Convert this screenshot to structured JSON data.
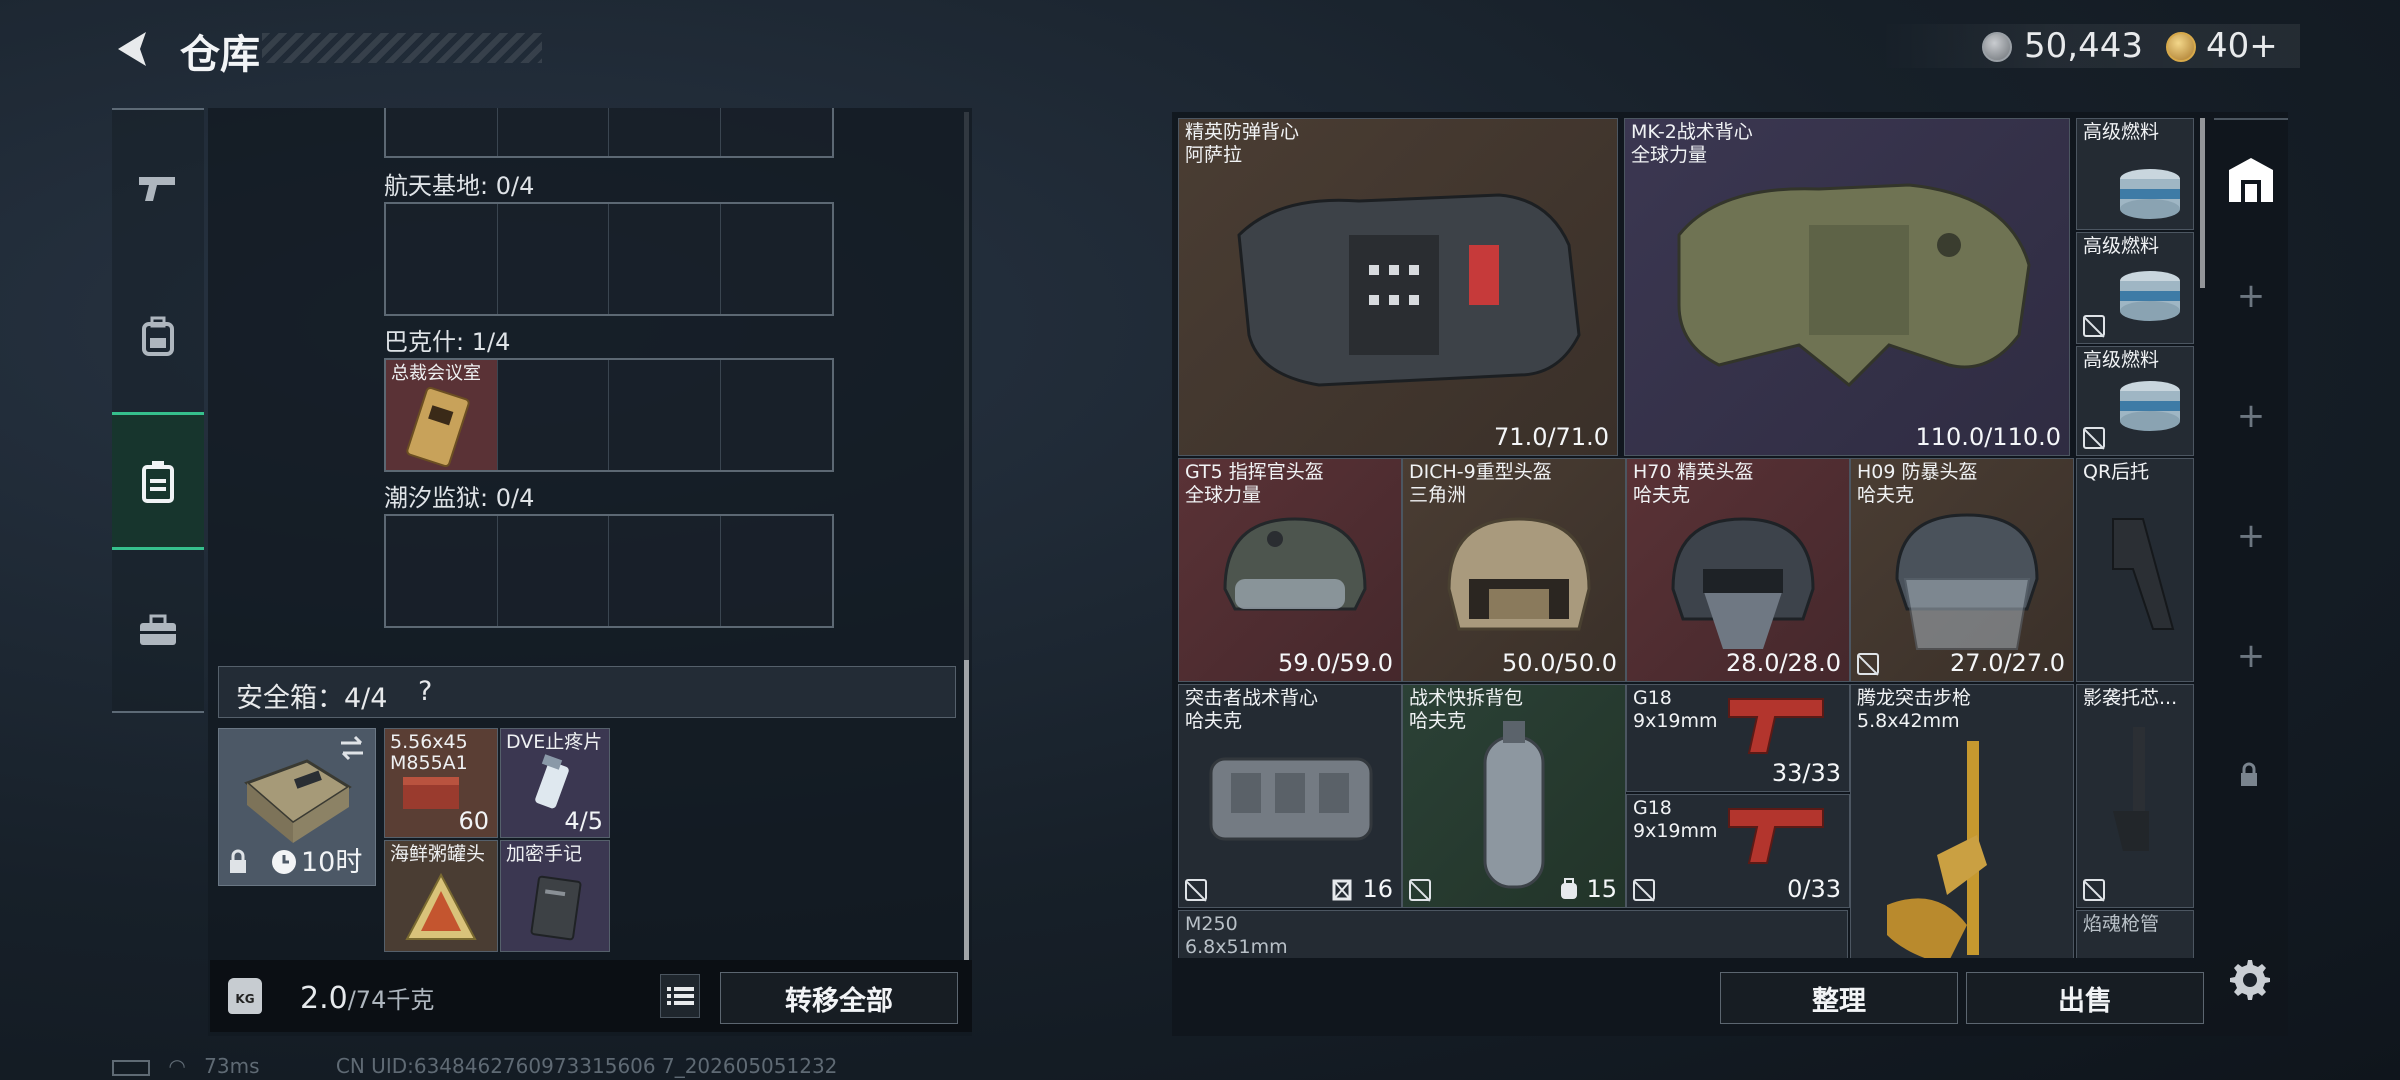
{
  "header": {
    "title": "仓库",
    "currency_silver": "50,443",
    "currency_gold": "40+"
  },
  "left_nav": {
    "items": [
      "weapons-icon",
      "backpack-icon",
      "inventory-icon",
      "toolbox-icon"
    ]
  },
  "storage": {
    "sections": [
      {
        "label": "航天基地: 0/4"
      },
      {
        "label": "巴克什: 1/4",
        "item": "总裁会议室"
      },
      {
        "label": "潮汐监狱: 0/4"
      }
    ]
  },
  "safebox": {
    "title": "安全箱：4/4",
    "help": "?",
    "time": "10时",
    "items": [
      {
        "name": "5.56x45\nM855A1",
        "count": "60"
      },
      {
        "name": "DVE止疼片",
        "count": "4/5"
      },
      {
        "name": "海鲜粥罐头",
        "count": ""
      },
      {
        "name": "加密手记",
        "count": ""
      }
    ]
  },
  "weight": {
    "value": "2.0",
    "max": "/74千克"
  },
  "buttons": {
    "transfer_all": "转移全部",
    "sort": "整理",
    "sell": "出售"
  },
  "items": [
    {
      "name": "精英防弹背心",
      "sub": "阿萨拉",
      "value": "71.0/71.0"
    },
    {
      "name": "MK-2战术背心",
      "sub": "全球力量",
      "value": "110.0/110.0"
    },
    {
      "name": "高级燃料",
      "sub": "",
      "value": ""
    },
    {
      "name": "高级燃料",
      "sub": "",
      "value": ""
    },
    {
      "name": "高级燃料",
      "sub": "",
      "value": ""
    },
    {
      "name": "GT5 指挥官头盔",
      "sub": "全球力量",
      "value": "59.0/59.0"
    },
    {
      "name": "DICH-9重型头盔",
      "sub": "三角洲",
      "value": "50.0/50.0"
    },
    {
      "name": "H70 精英头盔",
      "sub": "哈夫克",
      "value": "28.0/28.0"
    },
    {
      "name": "H09 防暴头盔",
      "sub": "哈夫克",
      "value": "27.0/27.0"
    },
    {
      "name": "QR后托",
      "sub": "",
      "value": ""
    },
    {
      "name": "突击者战术背心",
      "sub": "哈夫克",
      "value": "16"
    },
    {
      "name": "战术快拆背包",
      "sub": "哈夫克",
      "value": "15"
    },
    {
      "name": "G18",
      "sub": "9x19mm",
      "value": "33/33"
    },
    {
      "name": "G18",
      "sub": "9x19mm",
      "value": "0/33"
    },
    {
      "name": "腾龙突击步枪",
      "sub": "5.8x42mm",
      "value": ""
    },
    {
      "name": "影袭托芯...",
      "sub": "",
      "value": ""
    },
    {
      "name": "M250",
      "sub": "6.8x51mm",
      "value": ""
    },
    {
      "name": "焰魂枪管",
      "sub": "",
      "value": ""
    }
  ],
  "status": {
    "ping": "73ms",
    "uid": "CN UID:6348462760973315606 7_202605051232"
  },
  "colors": {
    "accent_green": "#36c08d",
    "brown": "#4a3d33",
    "purple": "#3b3751",
    "red": "#5a3236",
    "green": "#2b4136"
  }
}
